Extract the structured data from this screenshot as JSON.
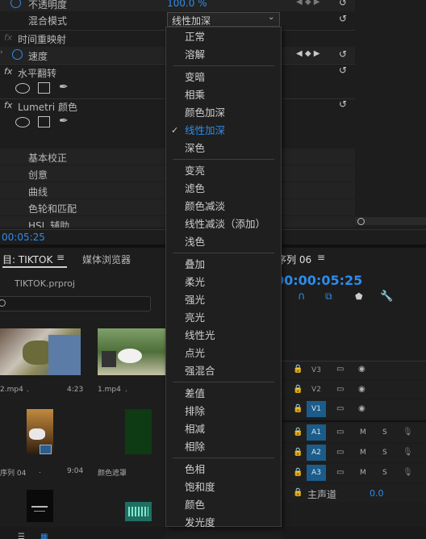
{
  "effects": {
    "opacity_label": "不透明度",
    "opacity_value": "100.0 %",
    "blend_label": "混合模式",
    "blend_value": "线性加深",
    "time_remap_label": "时间重映射",
    "speed_label": "速度",
    "hflip_label": "水平翻转",
    "lumetri_label": "Lumetri 颜色",
    "sections": [
      "基本校正",
      "创意",
      "曲线",
      "色轮和匹配",
      "HSL 辅助"
    ],
    "timecode": "00:05:25",
    "fx_glyph": "fx"
  },
  "blend_menu": {
    "groups": [
      [
        "正常",
        "溶解"
      ],
      [
        "变暗",
        "相乘",
        "颜色加深",
        "线性加深",
        "深色"
      ],
      [
        "变亮",
        "滤色",
        "颜色减淡",
        "线性减淡（添加）",
        "浅色"
      ],
      [
        "叠加",
        "柔光",
        "强光",
        "亮光",
        "线性光",
        "点光",
        "强混合"
      ],
      [
        "差值",
        "排除",
        "相减",
        "相除"
      ],
      [
        "色相",
        "饱和度",
        "颜色",
        "发光度"
      ]
    ],
    "selected": "线性加深",
    "check_glyph": "✓"
  },
  "project": {
    "tab_label": "目: TIKTOK",
    "menu_glyph": "≡",
    "media_browser_tab": "媒体浏览器",
    "file_name": "TIKTOK.prproj",
    "items": [
      {
        "name": "2.mp4",
        "duration": "4:23",
        "dots": "."
      },
      {
        "name": "1.mp4",
        "duration": "",
        "dots": "."
      },
      {
        "name": "序列 04",
        "duration": "9:04",
        "dots": "."
      },
      {
        "name": "颜色遮罩",
        "duration": "",
        "dots": ""
      }
    ]
  },
  "timeline": {
    "sequence_tab": "序列 06",
    "menu_glyph": "≡",
    "timecode": "00:00:05:25",
    "tracks_video": [
      "V3",
      "V2",
      "V1"
    ],
    "tracks_audio": [
      "A1",
      "A2",
      "A3"
    ],
    "mute": "M",
    "solo": "S",
    "master_label": "主声道",
    "master_value": "0.0"
  },
  "colors": {
    "accent": "#2d8ceb",
    "panel_bg": "#1d1d1d",
    "menu_bg": "#1f1f1f",
    "track_on": "#1b5c8a"
  }
}
